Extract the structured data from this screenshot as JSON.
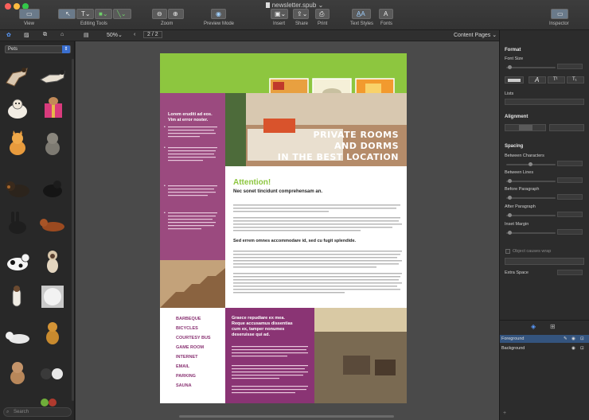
{
  "window": {
    "title": "newsletter.spub"
  },
  "toolbar": {
    "view_label": "View",
    "editing_tools_label": "Editing Tools",
    "zoom_label": "Zoom",
    "preview_label": "Preview Mode",
    "insert_label": "Insert",
    "share_label": "Share",
    "print_label": "Print",
    "text_styles_label": "Text Styles",
    "fonts_label": "Fonts",
    "inspector_label": "Inspector"
  },
  "subbar": {
    "zoom_value": "50%",
    "page_indicator": "2 / 2",
    "content_pages_label": "Content Pages"
  },
  "library": {
    "category": "Pets",
    "search_placeholder": "Search"
  },
  "document": {
    "headline_line1": "PRIVATE ROOMS",
    "headline_line2": "AND DORMS",
    "headline_line3": "IN THE BEST LOCATION",
    "sidebar_heading_line1": "Lorem eruditi ad eos.",
    "sidebar_heading_line2": "Vim at error noster.",
    "attention": "Attention!",
    "subheading1": "Nec sonet tincidunt comprehensam an.",
    "subheading2": "Sed errem omnes accommodare id, sed cu fugit splendide.",
    "purple_heading_line1": "Graece repudiare ex mea.",
    "purple_heading_line2": "Reque accusamus dissentias",
    "purple_heading_line3": "cum ex, tamper nonumes",
    "purple_heading_line4": "deseruisse qui ad.",
    "amenities": [
      "BARBEQUE",
      "BICYCLES",
      "COURTESY BUS",
      "GAME ROOM",
      "INTERNET",
      "EMAIL",
      "PARKING",
      "SAUNA"
    ]
  },
  "inspector": {
    "format_heading": "Format",
    "font_size_label": "Font Size",
    "lists_label": "Lists",
    "alignment_heading": "Alignment",
    "spacing_heading": "Spacing",
    "between_characters_label": "Between Characters",
    "between_lines_label": "Between Lines",
    "before_paragraph_label": "Before Paragraph",
    "after_paragraph_label": "After Paragraph",
    "inset_margin_label": "Inset Margin",
    "object_wrap_label": "Object causes wrap",
    "extra_space_label": "Extra Space",
    "layers": [
      "Foreground",
      "Background"
    ]
  },
  "colors": {
    "accent_green": "#8dc63f",
    "accent_purple": "#9b4a7f",
    "amenity_purple": "#8a3474",
    "selection_blue": "#3a6fd0"
  }
}
